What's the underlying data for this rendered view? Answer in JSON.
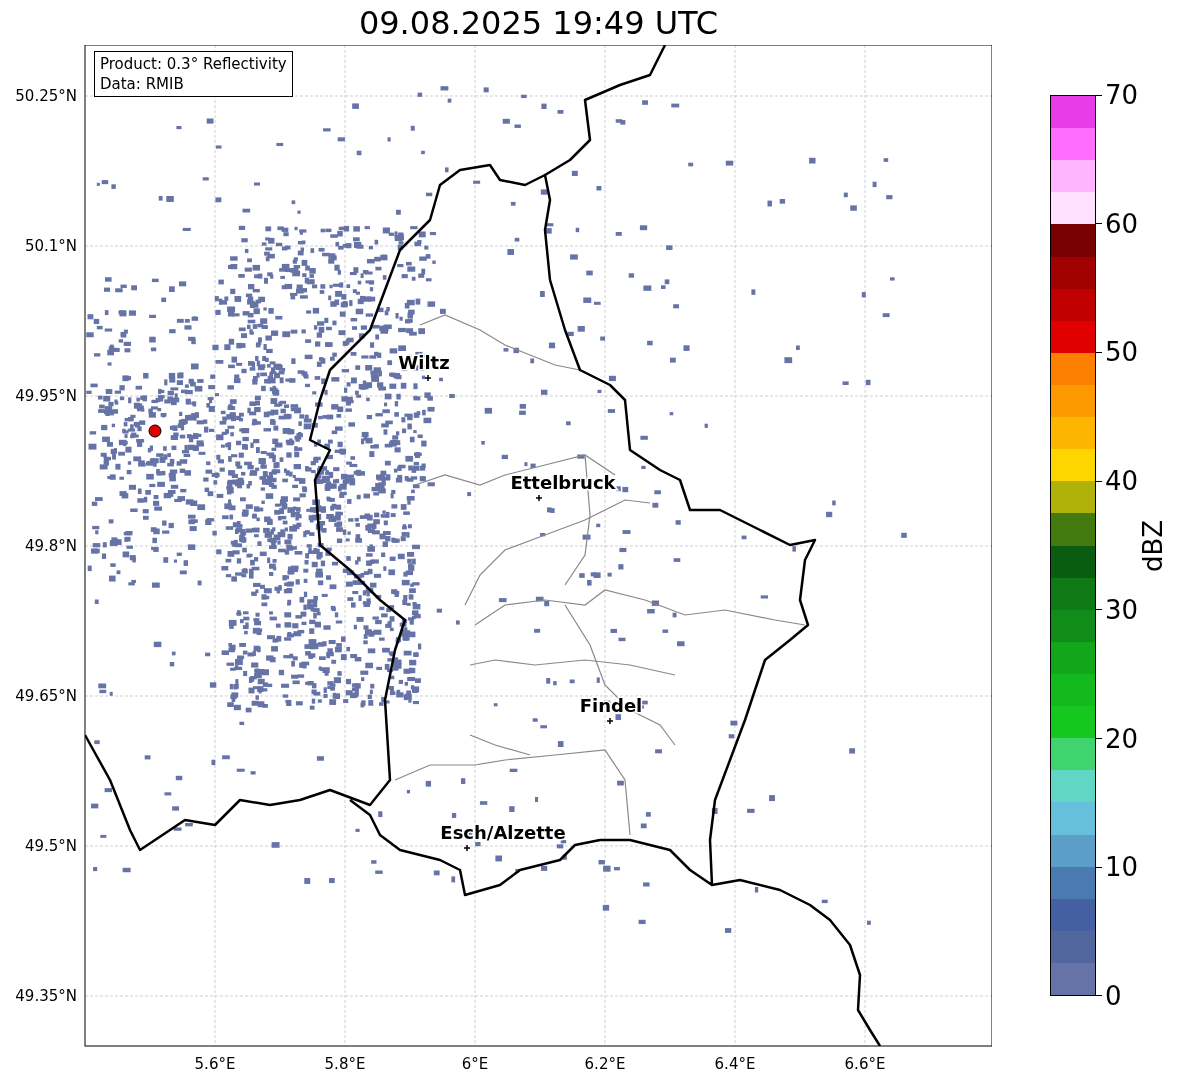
{
  "title": "09.08.2025 19:49 UTC",
  "info_box": {
    "lines": [
      "Product: 0.3° Reflectivity",
      "Data: RMIB"
    ]
  },
  "lat_ticks": [
    "50.25°N",
    "50.1°N",
    "49.95°N",
    "49.8°N",
    "49.65°N",
    "49.5°N",
    "49.35°N"
  ],
  "lon_ticks": [
    "5.6°E",
    "5.8°E",
    "6°E",
    "6.2°E",
    "6.4°E",
    "6.6°E"
  ],
  "cities": [
    {
      "name": "Wiltz"
    },
    {
      "name": "Ettelbruck"
    },
    {
      "name": "Findel"
    },
    {
      "name": "Esch/Alzette"
    }
  ],
  "colorbar": {
    "label": "dBZ",
    "ticks": [
      "70",
      "60",
      "50",
      "40",
      "30",
      "20",
      "10",
      "0"
    ],
    "segments": [
      {
        "color": "#e83ce8"
      },
      {
        "color": "#ff6eff"
      },
      {
        "color": "#ffb4ff"
      },
      {
        "color": "#ffe0ff"
      },
      {
        "color": "#780000"
      },
      {
        "color": "#a00000"
      },
      {
        "color": "#c00000"
      },
      {
        "color": "#e00000"
      },
      {
        "color": "#fd7f00"
      },
      {
        "color": "#fd9a00"
      },
      {
        "color": "#fdb500"
      },
      {
        "color": "#fdd600"
      },
      {
        "color": "#b0b20a"
      },
      {
        "color": "#437a10"
      },
      {
        "color": "#0a5c10"
      },
      {
        "color": "#0d7a16"
      },
      {
        "color": "#118c19"
      },
      {
        "color": "#12a61a"
      },
      {
        "color": "#14b91e"
      },
      {
        "color": "#14c81e"
      },
      {
        "color": "#3fd46e"
      },
      {
        "color": "#62d6c6"
      },
      {
        "color": "#66c0dc"
      },
      {
        "color": "#5b9fc8"
      },
      {
        "color": "#4a7ab0"
      },
      {
        "color": "#4560a2"
      },
      {
        "color": "#52669e"
      },
      {
        "color": "#6673a6"
      }
    ]
  }
}
